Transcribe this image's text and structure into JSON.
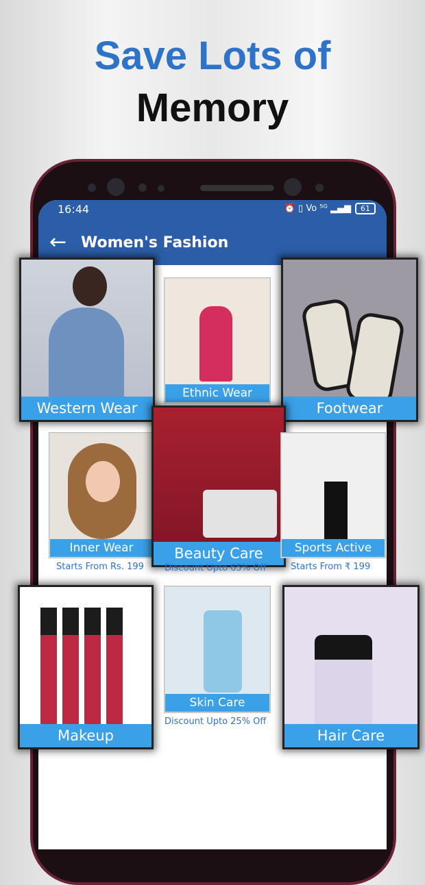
{
  "headline": {
    "line1": "Save Lots of",
    "line2": "Memory"
  },
  "status_bar": {
    "time": "16:44",
    "icons": "⏰ ▯ Vo ⁵ᴳ ▂▄▆",
    "battery": "61"
  },
  "app_bar": {
    "back_icon": "←",
    "title": "Women's Fashion"
  },
  "categories": [
    {
      "label": "Western Wear",
      "subtitle": ""
    },
    {
      "label": "Ethnic Wear",
      "subtitle": ""
    },
    {
      "label": "Footwear",
      "subtitle": ""
    },
    {
      "label": "Inner Wear",
      "subtitle": "Starts From Rs. 199"
    },
    {
      "label": "Beauty Care",
      "subtitle": "Discount Upto 65% Off"
    },
    {
      "label": "Sports Active",
      "subtitle": "Starts From ₹ 199"
    },
    {
      "label": "Makeup",
      "subtitle": ""
    },
    {
      "label": "Skin Care",
      "subtitle": "Discount Upto 25% Off"
    },
    {
      "label": "Hair Care",
      "subtitle": ""
    }
  ],
  "colors": {
    "headline_blue": "#2f73c9",
    "app_bar": "#2b5da8",
    "label_bar": "#3aa0e8"
  },
  "icons": {
    "back": "arrow-left-icon",
    "alarm": "alarm-icon",
    "vibrate": "vibrate-icon",
    "signal": "signal-icon",
    "battery": "battery-icon"
  }
}
